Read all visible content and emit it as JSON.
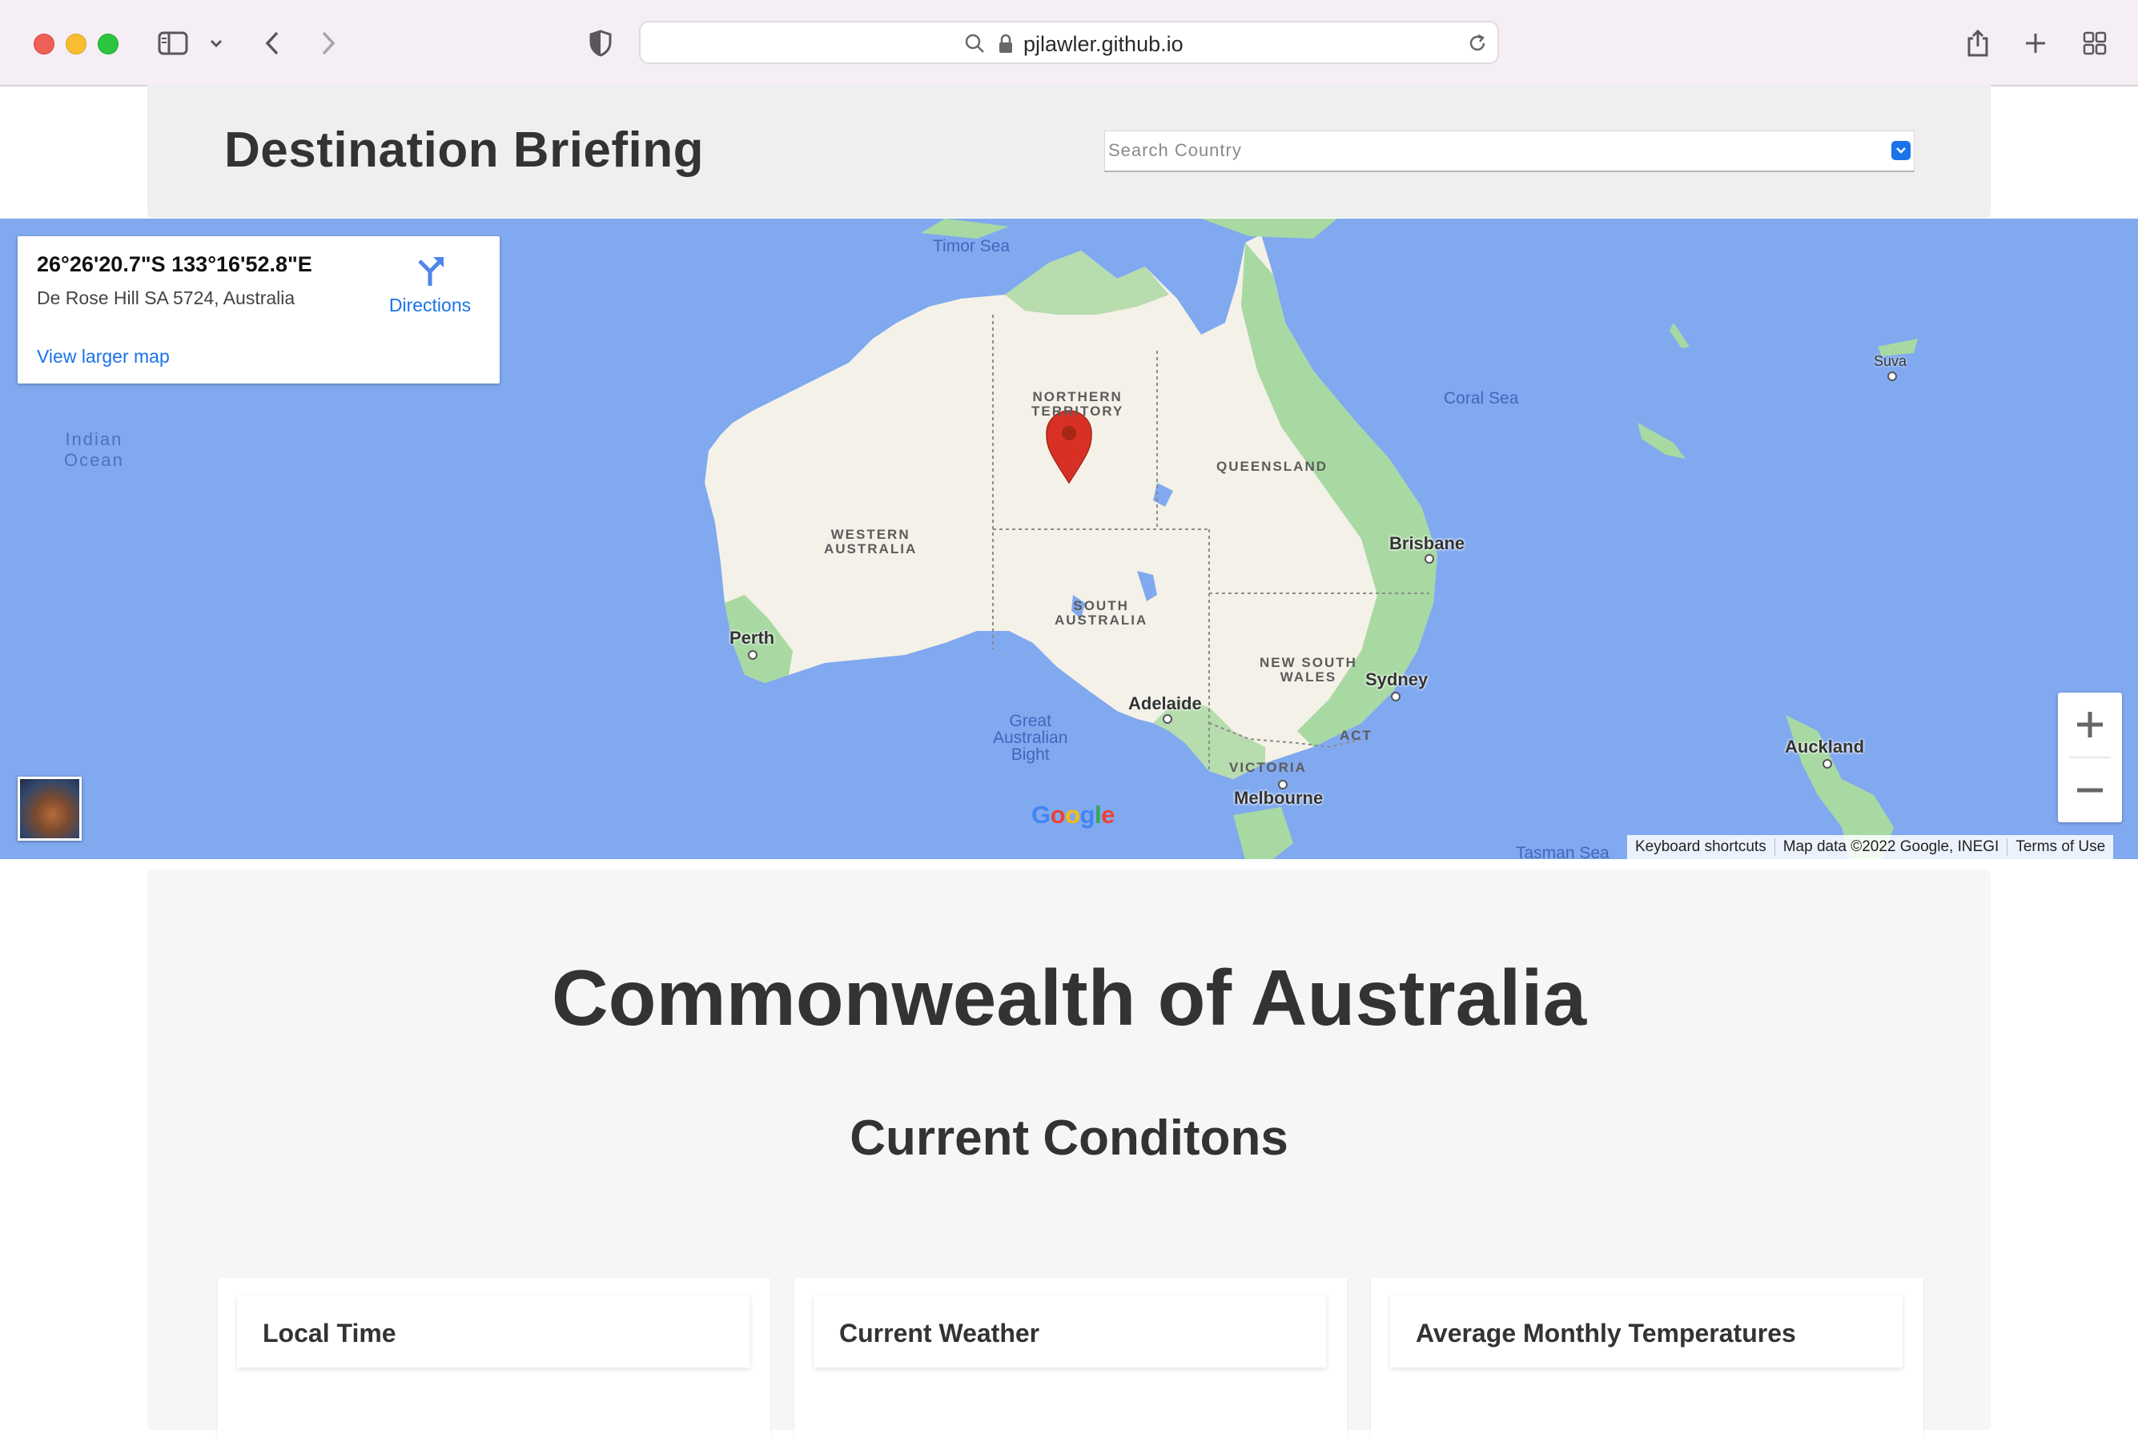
{
  "browser": {
    "url": "pjlawler.github.io"
  },
  "header": {
    "title": "Destination Briefing",
    "search_placeholder": "Search Country"
  },
  "map": {
    "info_card": {
      "coordinates": "26°26'20.7\"S 133°16'52.8\"E",
      "address": "De Rose Hill SA 5724, Australia",
      "directions_label": "Directions",
      "larger_map_label": "View larger map"
    },
    "labels": {
      "indian_ocean_1": "Indian",
      "indian_ocean_2": "Ocean",
      "timor_sea": "Timor Sea",
      "coral_sea": "Coral Sea",
      "gab_1": "Great",
      "gab_2": "Australian",
      "gab_3": "Bight",
      "tasman_sea": "Tasman Sea",
      "nt_1": "NORTHERN",
      "nt_2": "TERRITORY",
      "qld": "QUEENSLAND",
      "wa_1": "WESTERN",
      "wa_2": "AUSTRALIA",
      "sa_1": "SOUTH",
      "sa_2": "AUSTRALIA",
      "nsw_1": "NEW SOUTH",
      "nsw_2": "WALES",
      "act": "ACT",
      "vic": "VICTORIA",
      "perth": "Perth",
      "adelaide": "Adelaide",
      "melbourne": "Melbourne",
      "sydney": "Sydney",
      "brisbane": "Brisbane",
      "auckland": "Auckland",
      "suva": "Suva"
    },
    "google_logo": "Google",
    "attribution": {
      "shortcuts": "Keyboard shortcuts",
      "map_data": "Map data ©2022 Google, INEGI",
      "terms": "Terms of Use"
    },
    "colors": {
      "water": "#81a9ef",
      "land": "#f4f1e8",
      "vegetation": "#a8d9a3",
      "marker": "#d93025"
    }
  },
  "content": {
    "country_name": "Commonwealth of Australia",
    "conditions_heading": "Current Conditons",
    "cards": [
      {
        "title": "Local Time"
      },
      {
        "title": "Current Weather"
      },
      {
        "title": "Average Monthly Temperatures"
      }
    ]
  }
}
